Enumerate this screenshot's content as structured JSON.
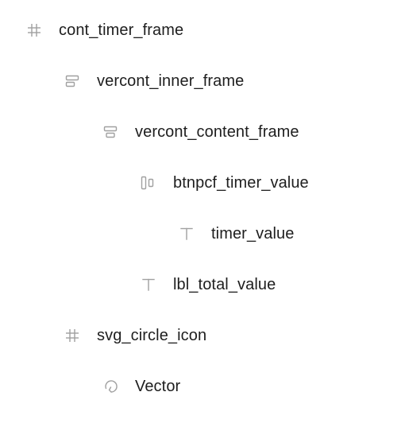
{
  "layers": [
    {
      "name": "cont_timer_frame",
      "icon": "frame-hash-icon",
      "depth": 0
    },
    {
      "name": "vercont_inner_frame",
      "icon": "vertical-autolayout-icon",
      "depth": 1
    },
    {
      "name": "vercont_content_frame",
      "icon": "vertical-autolayout-icon",
      "depth": 2
    },
    {
      "name": "btnpcf_timer_value",
      "icon": "horizontal-autolayout-icon",
      "depth": 3
    },
    {
      "name": "timer_value",
      "icon": "text-icon",
      "depth": 4
    },
    {
      "name": "lbl_total_value",
      "icon": "text-icon",
      "depth": 3
    },
    {
      "name": "svg_circle_icon",
      "icon": "frame-hash-icon",
      "depth": 1
    },
    {
      "name": "Vector",
      "icon": "vector-icon",
      "depth": 2
    }
  ],
  "colors": {
    "text": "#1e1e1e",
    "icon": "#a0a0a0"
  }
}
